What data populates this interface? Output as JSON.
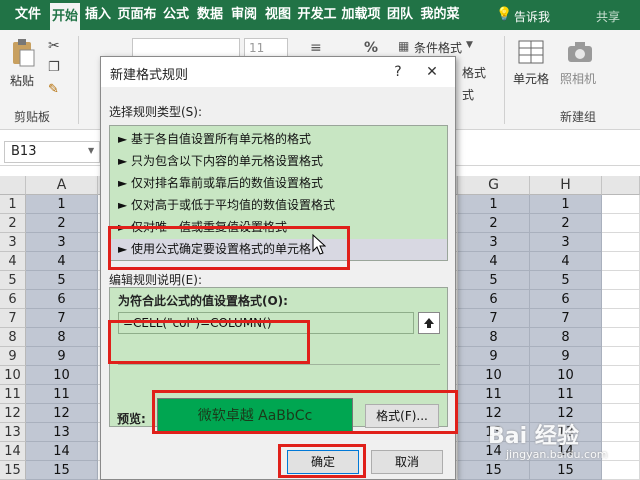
{
  "ribbon_tabs": [
    "文件",
    "开始",
    "插入",
    "页面布",
    "公式",
    "数据",
    "审阅",
    "视图",
    "开发工",
    "加载项",
    "团队",
    "我的菜"
  ],
  "tell_me": "告诉我",
  "share": "共享",
  "ribbon": {
    "paste": "粘贴",
    "clipboard": "剪贴板",
    "font_size": "11",
    "cond_format": "条件格式",
    "cell": "单元格",
    "camera": "照相机",
    "new_group": "新建组",
    "format_tail": "格式",
    "style_tail": "式"
  },
  "name_box": "B13",
  "columns_left": [
    "A"
  ],
  "columns_right": [
    "G",
    "H"
  ],
  "rows": [
    "1",
    "2",
    "3",
    "4",
    "5",
    "6",
    "7",
    "8",
    "9",
    "10",
    "11",
    "12",
    "13",
    "14",
    "15"
  ],
  "col_a": [
    "1",
    "2",
    "3",
    "4",
    "5",
    "6",
    "7",
    "8",
    "9",
    "10",
    "11",
    "12",
    "13",
    "14",
    "15"
  ],
  "col_g": [
    "1",
    "2",
    "3",
    "4",
    "5",
    "6",
    "7",
    "8",
    "9",
    "10",
    "11",
    "12",
    "13",
    "14",
    "15"
  ],
  "col_h": [
    "1",
    "2",
    "3",
    "4",
    "5",
    "6",
    "7",
    "8",
    "9",
    "10",
    "11",
    "12",
    "13",
    "14",
    "15"
  ],
  "dialog": {
    "title": "新建格式规则",
    "help": "?",
    "close": "✕",
    "select_rule_type": "选择规则类型(S):",
    "rules": [
      "► 基于各自值设置所有单元格的格式",
      "► 只为包含以下内容的单元格设置格式",
      "► 仅对排名靠前或靠后的数值设置格式",
      "► 仅对高于或低于平均值的数值设置格式",
      "► 仅对唯一值或重复值设置格式",
      "► 使用公式确定要设置格式的单元格"
    ],
    "selected_rule_index": 5,
    "edit_rule_desc": "编辑规则说明(E):",
    "formula_label": "为符合此公式的值设置格式(O):",
    "formula_value": "=CELL(\"col\")=COLUMN()",
    "preview_label": "预览:",
    "preview_text": "微软卓越  AaBbCc",
    "preview_color": "#00a651",
    "format_button": "格式(F)...",
    "ok_button": "确定",
    "cancel_button": "取消"
  },
  "watermark": "Bai 经验",
  "watermark_url": "jingyan.baidu.com"
}
